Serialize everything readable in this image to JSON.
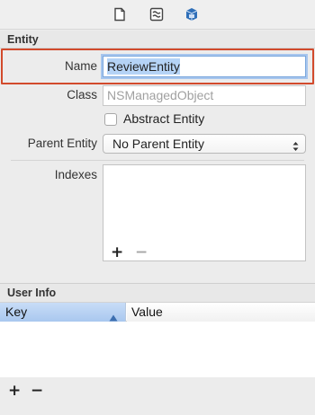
{
  "toolbar": {
    "icons": [
      "file-inspector-icon",
      "quick-help-icon",
      "data-model-inspector-icon"
    ],
    "colors": {
      "active_icon": "#2f6fb8",
      "inactive_icon": "#555555"
    }
  },
  "entity": {
    "section_title": "Entity",
    "name_label": "Name",
    "name_value": "ReviewEntity",
    "class_label": "Class",
    "class_placeholder": "NSManagedObject",
    "abstract_label": "Abstract Entity",
    "abstract_checked": false,
    "parent_label": "Parent Entity",
    "parent_value": "No Parent Entity",
    "indexes_label": "Indexes",
    "indexes_add": "+",
    "indexes_remove": "−"
  },
  "user_info": {
    "section_title": "User Info",
    "columns": [
      "Key",
      "Value"
    ],
    "rows": [],
    "add": "+",
    "remove": "−"
  },
  "highlight_color": "#d24a2c"
}
